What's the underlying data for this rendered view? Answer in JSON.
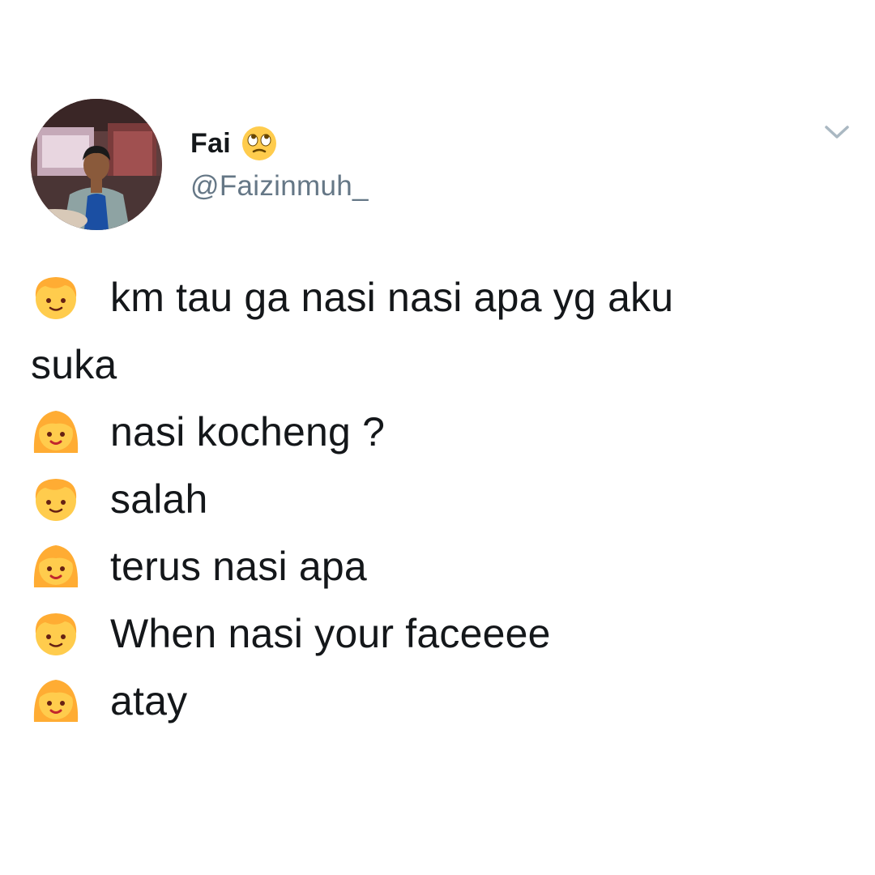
{
  "tweet": {
    "author": {
      "display_name": "Fai",
      "name_emoji": "face-with-rolling-eyes-icon",
      "handle": "@Faizinmuh_"
    },
    "lines": [
      {
        "speaker": "boy",
        "text": "km tau ga nasi nasi apa yg aku"
      },
      {
        "speaker": null,
        "text": "suka"
      },
      {
        "speaker": "girl",
        "text": "nasi kocheng ?"
      },
      {
        "speaker": "boy",
        "text": "salah"
      },
      {
        "speaker": "girl",
        "text": "terus nasi apa"
      },
      {
        "speaker": "boy",
        "text": "When nasi your faceeee"
      },
      {
        "speaker": "girl",
        "text": "atay"
      }
    ]
  },
  "colors": {
    "text": "#14171a",
    "handle": "#657786",
    "emoji_skin": "#ffcc4d",
    "emoji_hair": "#ffac33",
    "caret": "#aab8c2"
  }
}
